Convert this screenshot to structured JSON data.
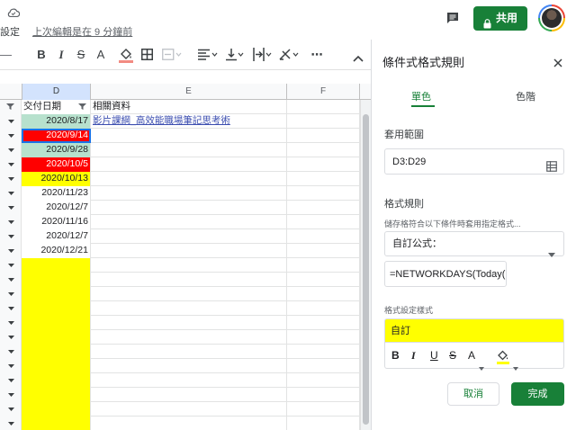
{
  "topbar": {
    "settings_label": "設定",
    "last_edit": "上次編輯是在 9 分鐘前",
    "share_label": "共用",
    "colors": {
      "share_bg": "#188038"
    }
  },
  "toolbar": {
    "bold": "B",
    "italic": "I",
    "strike": "S",
    "text_color": "A",
    "more": "⋯",
    "collapse": "^"
  },
  "columns": {
    "d": "D",
    "e": "E",
    "f": "F"
  },
  "header_row": {
    "d": "交付日期",
    "e": "相關資料"
  },
  "rows": [
    {
      "d": "2020/8/17",
      "e": "影片課綱_高效能職場筆記思考術",
      "bg": "#b7e1cd",
      "color": "#202124"
    },
    {
      "d": "2020/9/14",
      "e": "",
      "bg": "#ff0000",
      "color": "#ffffff"
    },
    {
      "d": "2020/9/28",
      "e": "",
      "bg": "#b7e1cd",
      "color": "#202124"
    },
    {
      "d": "2020/10/5",
      "e": "",
      "bg": "#ff0000",
      "color": "#ffffff"
    },
    {
      "d": "2020/10/13",
      "e": "",
      "bg": "#ffff00",
      "color": "#202124"
    },
    {
      "d": "2020/11/23",
      "e": "",
      "bg": "#ffffff",
      "color": "#202124"
    },
    {
      "d": "2020/12/7",
      "e": "",
      "bg": "#ffffff",
      "color": "#202124"
    },
    {
      "d": "2020/11/16",
      "e": "",
      "bg": "#ffffff",
      "color": "#202124"
    },
    {
      "d": "2020/12/7",
      "e": "",
      "bg": "#ffffff",
      "color": "#202124"
    },
    {
      "d": "2020/12/21",
      "e": "",
      "bg": "#ffffff",
      "color": "#202124"
    }
  ],
  "empty_rows": 12,
  "panel": {
    "title": "條件式格式規則",
    "tab_single": "單色",
    "tab_scale": "色階",
    "range_label": "套用範圍",
    "range_value": "D3:D29",
    "rules_label": "格式規則",
    "condition_hint": "儲存格符合以下條件時套用指定格式...",
    "condition_value": "自訂公式：",
    "formula_value": "=NETWORKDAYS(Today(",
    "style_label": "格式設定樣式",
    "style_preview": "自訂",
    "fmt_bold": "B",
    "fmt_italic": "I",
    "fmt_underline": "U",
    "fmt_strike": "S",
    "fmt_text": "A",
    "cancel_label": "取消",
    "done_label": "完成",
    "colors": {
      "accent": "#188038",
      "preview_bg": "#ffff00",
      "fill_swatch": "#ffff00"
    }
  }
}
